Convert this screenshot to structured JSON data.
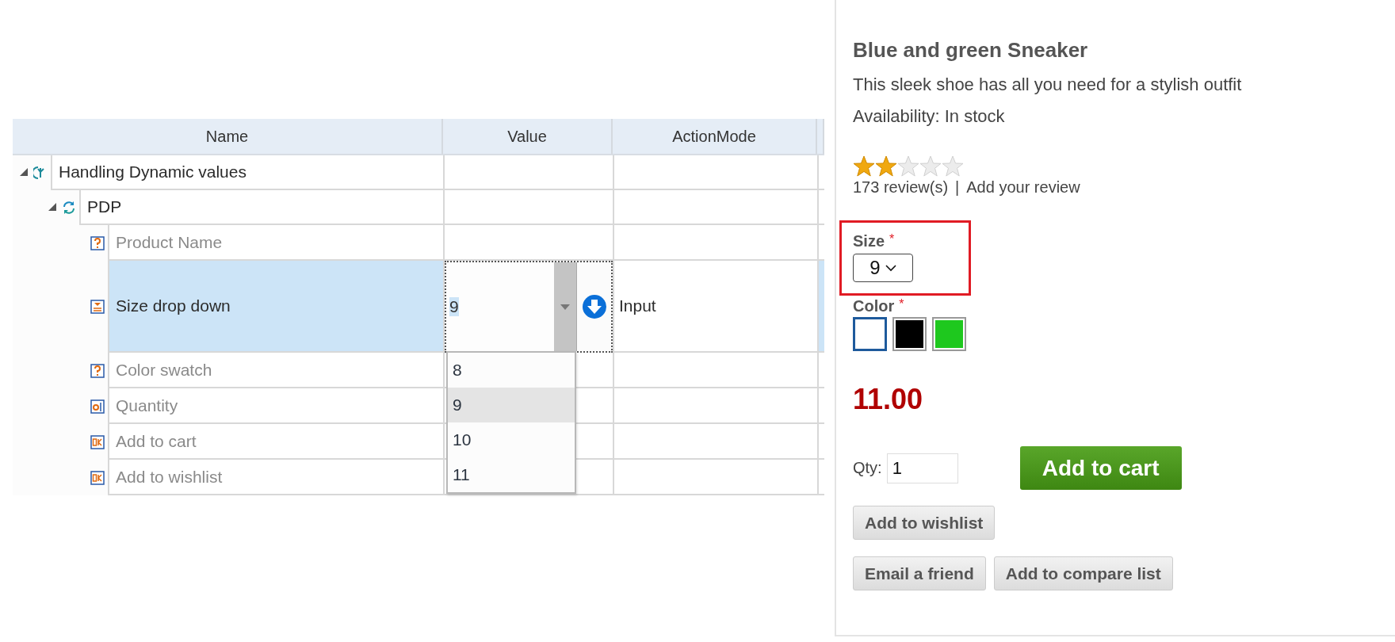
{
  "tree": {
    "columns": [
      "Name",
      "Value",
      "ActionMode"
    ],
    "nodes": [
      {
        "kind": "root",
        "name": "Handling Dynamic values",
        "expanded": true,
        "children": [
          {
            "kind": "group",
            "name": "PDP",
            "expanded": true,
            "children": [
              {
                "kind": "question",
                "name": "Product Name",
                "selected": false
              },
              {
                "kind": "dropdown",
                "name": "Size drop down",
                "selected": true,
                "value": "9",
                "action_mode": "Input",
                "dropdown_open": true,
                "options": [
                  {
                    "label": "8",
                    "selected": false
                  },
                  {
                    "label": "9",
                    "selected": true
                  },
                  {
                    "label": "10",
                    "selected": false
                  },
                  {
                    "label": "11",
                    "selected": false
                  }
                ]
              },
              {
                "kind": "question",
                "name": "Color swatch",
                "selected": false
              },
              {
                "kind": "text",
                "name": "Quantity",
                "selected": false
              },
              {
                "kind": "button",
                "name": "Add to cart",
                "selected": false
              },
              {
                "kind": "button",
                "name": "Add to wishlist",
                "selected": false
              }
            ]
          }
        ]
      }
    ]
  },
  "product": {
    "title": "Blue and green Sneaker",
    "description": "This sleek shoe has all you need for a stylish outfit",
    "availability": "Availability: In stock",
    "stars": 2,
    "reviews": "173 review(s)",
    "separator": "|",
    "add_review": "Add your review",
    "size": {
      "label": "Size",
      "required": "*",
      "value": "9",
      "highlighted": true
    },
    "color": {
      "label": "Color",
      "required": "*",
      "swatches": [
        {
          "color": "#ffffff",
          "selected": true
        },
        {
          "color": "#000000",
          "selected": false
        },
        {
          "color": "#1ec81e",
          "selected": false
        }
      ]
    },
    "price": "11.00",
    "qty_label": "Qty:",
    "qty": "1",
    "add_to_cart": "Add to cart",
    "add_to_wishlist": "Add to wishlist",
    "email_friend": "Email a friend",
    "compare": "Add to compare list"
  }
}
